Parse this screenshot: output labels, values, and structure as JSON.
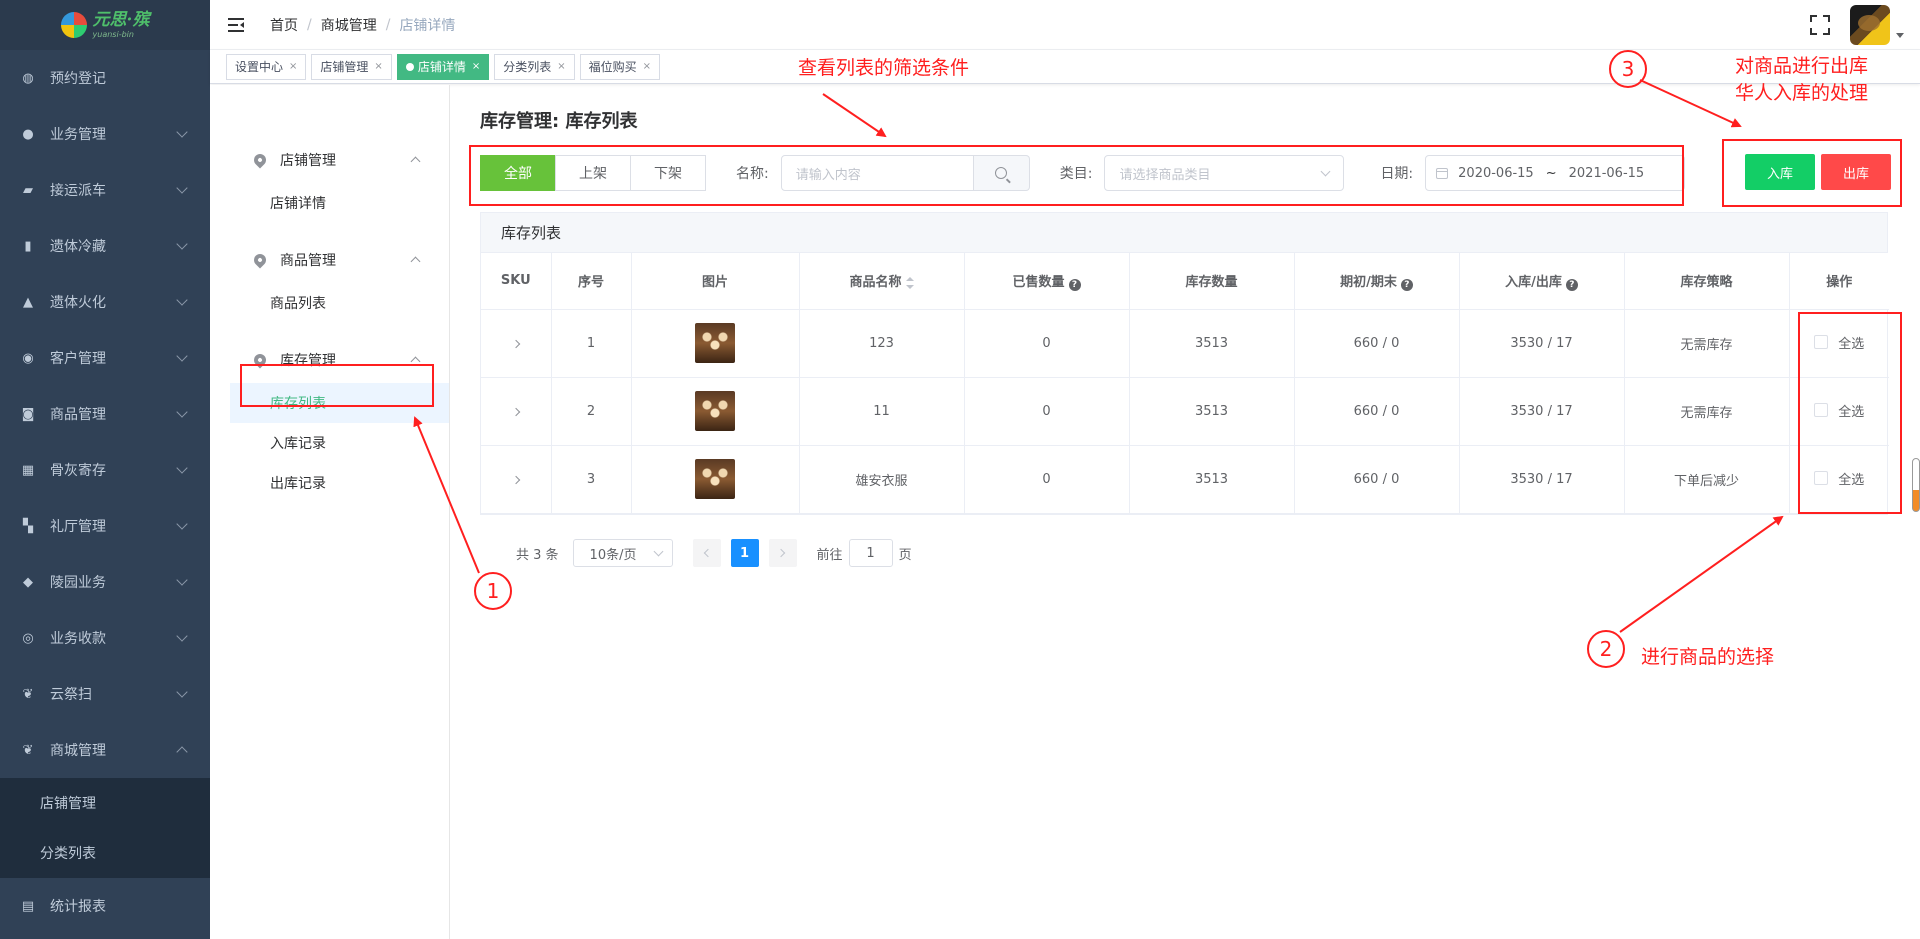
{
  "logo": {
    "name": "元思·殡",
    "sub": "yuansi-bin"
  },
  "sidebar": {
    "items": [
      {
        "label": "预约登记",
        "icon": "dashboard-icon",
        "glyph": "◍",
        "arrow": false
      },
      {
        "label": "业务管理",
        "icon": "chat-icon",
        "glyph": "●",
        "arrow": true
      },
      {
        "label": "接运派车",
        "icon": "truck-icon",
        "glyph": "▰",
        "arrow": true
      },
      {
        "label": "遗体冷藏",
        "icon": "thermometer-icon",
        "glyph": "▮",
        "arrow": true
      },
      {
        "label": "遗体火化",
        "icon": "fire-icon",
        "glyph": "▲",
        "arrow": true
      },
      {
        "label": "客户管理",
        "icon": "users-icon",
        "glyph": "◉",
        "arrow": true
      },
      {
        "label": "商品管理",
        "icon": "cart-icon",
        "glyph": "◙",
        "arrow": true
      },
      {
        "label": "骨灰寄存",
        "icon": "grid-icon",
        "glyph": "▦",
        "arrow": true
      },
      {
        "label": "礼厅管理",
        "icon": "hall-icon",
        "glyph": "▚",
        "arrow": true
      },
      {
        "label": "陵园业务",
        "icon": "cemetery-icon",
        "glyph": "◆",
        "arrow": true
      },
      {
        "label": "业务收款",
        "icon": "payment-icon",
        "glyph": "◎",
        "arrow": true
      },
      {
        "label": "云祭扫",
        "icon": "lotus-icon",
        "glyph": "❦",
        "arrow": true
      },
      {
        "label": "商城管理",
        "icon": "mall-icon",
        "glyph": "❦",
        "arrow": true,
        "open": true
      }
    ],
    "mall_sub": [
      "店铺管理",
      "分类列表"
    ],
    "bottom": {
      "label": "统计报表",
      "icon": "report-icon",
      "glyph": "▤"
    }
  },
  "breadcrumb": [
    "首页",
    "商城管理",
    "店铺详情"
  ],
  "tags": [
    {
      "label": "设置中心",
      "active": false
    },
    {
      "label": "店铺管理",
      "active": false
    },
    {
      "label": "店铺详情",
      "active": true
    },
    {
      "label": "分类列表",
      "active": false
    },
    {
      "label": "福位购买",
      "active": false
    }
  ],
  "submenu": {
    "groups": [
      {
        "label": "店铺管理",
        "items": [
          {
            "label": "店铺详情",
            "active": false
          }
        ]
      },
      {
        "label": "商品管理",
        "items": [
          {
            "label": "商品列表",
            "active": false
          }
        ]
      },
      {
        "label": "库存管理",
        "items": [
          {
            "label": "库存列表",
            "active": true
          },
          {
            "label": "入库记录",
            "active": false
          },
          {
            "label": "出库记录",
            "active": false
          }
        ]
      }
    ]
  },
  "page": {
    "title": "库存管理: 库存列表"
  },
  "filter": {
    "status_buttons": [
      "全部",
      "上架",
      "下架"
    ],
    "name_label": "名称:",
    "name_placeholder": "请输入内容",
    "category_label": "类目:",
    "category_placeholder": "请选择商品类目",
    "date_label": "日期:",
    "date_start": "2020-06-15",
    "date_sep": "~",
    "date_end": "2021-06-15"
  },
  "actions": {
    "stock_in": "入库",
    "stock_out": "出库"
  },
  "table": {
    "title": "库存列表",
    "columns": [
      "SKU",
      "序号",
      "图片",
      "商品名称",
      "已售数量",
      "库存数量",
      "期初/期末",
      "入库/出库",
      "库存策略",
      "操作"
    ],
    "rows": [
      {
        "index": "1",
        "name": "123",
        "sold": "0",
        "stock": "3513",
        "period": "660 / 0",
        "inout": "3530 / 17",
        "strategy": "无需库存",
        "select_label": "全选"
      },
      {
        "index": "2",
        "name": "11",
        "sold": "0",
        "stock": "3513",
        "period": "660 / 0",
        "inout": "3530 / 17",
        "strategy": "无需库存",
        "select_label": "全选"
      },
      {
        "index": "3",
        "name": "雄安衣服",
        "sold": "0",
        "stock": "3513",
        "period": "660 / 0",
        "inout": "3530 / 17",
        "strategy": "下单后减少",
        "select_label": "全选"
      }
    ]
  },
  "pagination": {
    "total": "共 3 条",
    "page_size": "10条/页",
    "current": "1",
    "goto_label": "前往",
    "goto_value": "1",
    "page_unit": "页"
  },
  "annotations": {
    "filter_note": "查看列表的筛选条件",
    "action_note_1": "对商品进行出库",
    "action_note_2": "华人入库的处理",
    "select_note": "进行商品的选择",
    "num1": "1",
    "num2": "2",
    "num3": "3",
    "color": "#ff1f1f"
  }
}
